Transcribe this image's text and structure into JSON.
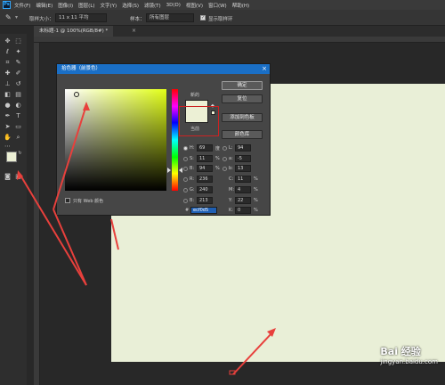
{
  "menubar": {
    "logo": "Ps",
    "items": [
      "文件(F)",
      "编辑(E)",
      "图像(I)",
      "图层(L)",
      "文字(Y)",
      "选择(S)",
      "滤镜(T)",
      "3D(D)",
      "视图(V)",
      "窗口(W)",
      "帮助(H)"
    ]
  },
  "options": {
    "sample_size_label": "取样大小：",
    "sample_size_value": "11 x 11 平均",
    "sample_label": "样本：",
    "sample_value": "所有图层",
    "show_ring_label": "显示取样环"
  },
  "document": {
    "tab_title": "未标题-1 @ 100%(RGB/8#) *"
  },
  "color_picker": {
    "title": "拾色器（前景色）",
    "new_label": "新的",
    "current_label": "当前",
    "buttons": {
      "ok": "确定",
      "reset": "复位",
      "add_swatch": "添加到色板",
      "libraries": "颜色库"
    },
    "web_only_label": "只有 Web 颜色",
    "fields": {
      "H": "69",
      "H_unit": "度",
      "S": "11",
      "S_unit": "%",
      "B": "94",
      "B_unit": "%",
      "R": "236",
      "G": "240",
      "B_rgb": "213",
      "L": "94",
      "a": "-5",
      "b": "13",
      "C": "11",
      "M": "4",
      "Y": "22",
      "K": "0",
      "cmyk_unit": "%"
    },
    "hex_label": "#",
    "hex_value": "ecf0d5"
  },
  "colors": {
    "foreground": "#ecf0d5",
    "canvas": "#e9efd7",
    "dialog_title": "#1a6fc6",
    "arrow": "#e8403c"
  },
  "watermark": {
    "brand": "Bai 经验",
    "url": "jingyan.baidu.com"
  }
}
